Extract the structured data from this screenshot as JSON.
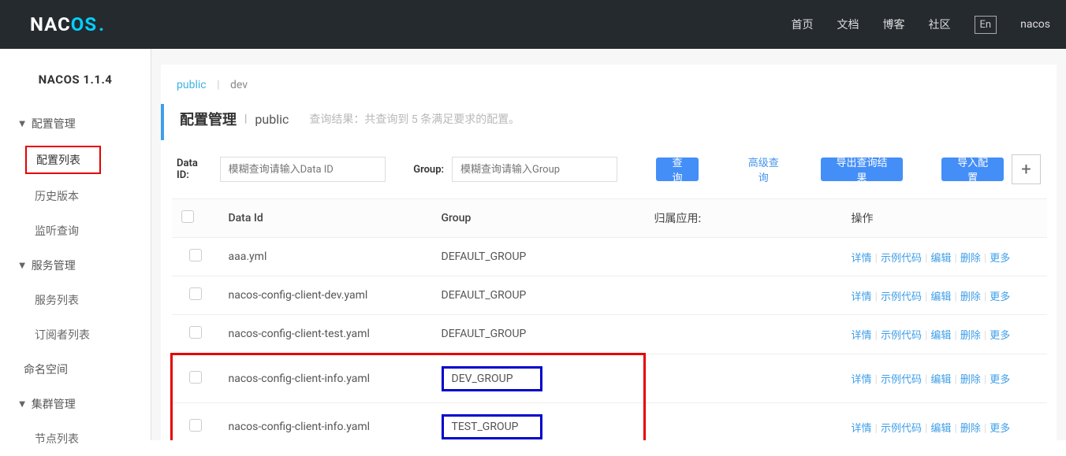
{
  "header": {
    "logo_left": "NAC",
    "logo_right": "OS",
    "nav": {
      "home": "首页",
      "docs": "文档",
      "blog": "博客",
      "community": "社区",
      "lang": "En",
      "user": "nacos"
    }
  },
  "sidebar": {
    "version": "NACOS 1.1.4",
    "config_mgmt": "配置管理",
    "config_list": "配置列表",
    "history": "历史版本",
    "listen_query": "监听查询",
    "service_mgmt": "服务管理",
    "service_list": "服务列表",
    "subscriber_list": "订阅者列表",
    "namespace": "命名空间",
    "cluster_mgmt": "集群管理",
    "node_list": "节点列表"
  },
  "tabs": {
    "public": "public",
    "dev": "dev"
  },
  "titlebar": {
    "title": "配置管理",
    "namespace": "public",
    "result_text": "查询结果：共查询到 5 条满足要求的配置。"
  },
  "filter": {
    "dataid_label": "Data ID:",
    "dataid_placeholder": "模糊查询请输入Data ID",
    "group_label": "Group:",
    "group_placeholder": "模糊查询请输入Group",
    "query_btn": "查询",
    "advanced": "高级查询",
    "export_btn": "导出查询结果",
    "import_btn": "导入配置"
  },
  "table": {
    "headers": {
      "dataid": "Data Id",
      "group": "Group",
      "app": "归属应用:",
      "ops": "操作"
    },
    "ops": {
      "detail": "详情",
      "sample": "示例代码",
      "edit": "编辑",
      "delete": "删除",
      "more": "更多"
    },
    "rows": [
      {
        "dataid": "aaa.yml",
        "group": "DEFAULT_GROUP",
        "app": "",
        "highlight": false,
        "group_boxed": false
      },
      {
        "dataid": "nacos-config-client-dev.yaml",
        "group": "DEFAULT_GROUP",
        "app": "",
        "highlight": false,
        "group_boxed": false
      },
      {
        "dataid": "nacos-config-client-test.yaml",
        "group": "DEFAULT_GROUP",
        "app": "",
        "highlight": false,
        "group_boxed": false
      },
      {
        "dataid": "nacos-config-client-info.yaml",
        "group": "DEV_GROUP",
        "app": "",
        "highlight": true,
        "group_boxed": true
      },
      {
        "dataid": "nacos-config-client-info.yaml",
        "group": "TEST_GROUP",
        "app": "",
        "highlight": true,
        "group_boxed": true
      }
    ]
  }
}
